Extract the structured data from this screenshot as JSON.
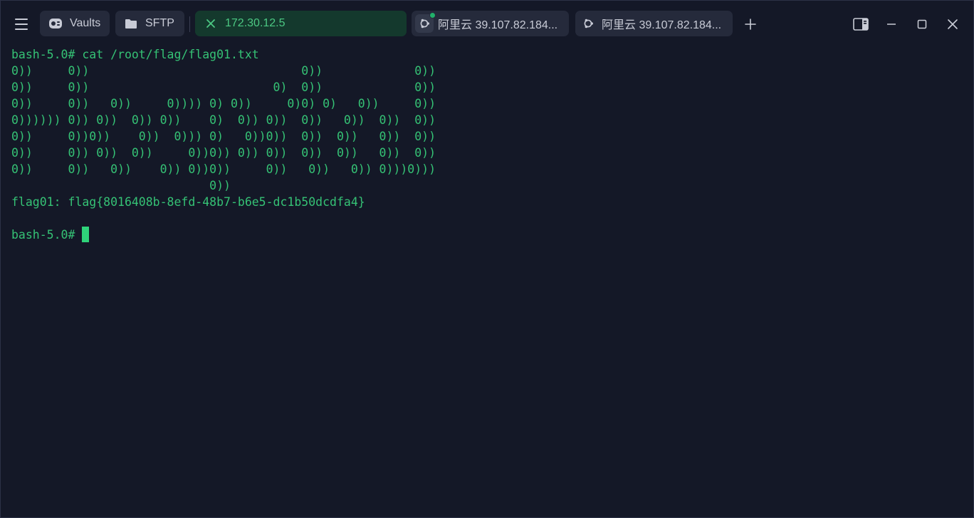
{
  "tabs": {
    "vaults": {
      "label": "Vaults",
      "icon": "vault-icon"
    },
    "sftp": {
      "label": "SFTP",
      "icon": "folder-icon"
    },
    "active": {
      "label": "172.30.12.5",
      "icon": "close-icon",
      "color": "#4cc883"
    },
    "ali1": {
      "label": "阿里云 39.107.82.184...",
      "icon": "ubuntu-icon"
    },
    "ali2": {
      "label": "阿里云 39.107.82.184...",
      "icon": "ubuntu-icon"
    }
  },
  "terminal": {
    "lines": [
      "bash-5.0# cat /root/flag/flag01.txt",
      "0))     0))                              0))             0))",
      "0))     0))                          0)  0))             0))",
      "0))     0))   0))     0)))) 0) 0))     0)0) 0)   0))     0))",
      "0)))))) 0)) 0))  0)) 0))    0)  0)) 0))  0))   0))  0))  0))",
      "0))     0))0))    0))  0))) 0)   0))0))  0))  0))   0))  0))",
      "0))     0)) 0))  0))     0))0)) 0)) 0))  0))  0))   0))  0))",
      "0))     0))   0))    0)) 0))0))     0))   0))   0)) 0)))0)))",
      "                            0))",
      "flag01: flag{8016408b-8efd-48b7-b6e5-dc1b50dcdfa4}",
      ""
    ],
    "prompt": "bash-5.0# "
  },
  "colors": {
    "background": "#141827",
    "terminal_text": "#35c275",
    "cursor": "#2fd37a"
  }
}
